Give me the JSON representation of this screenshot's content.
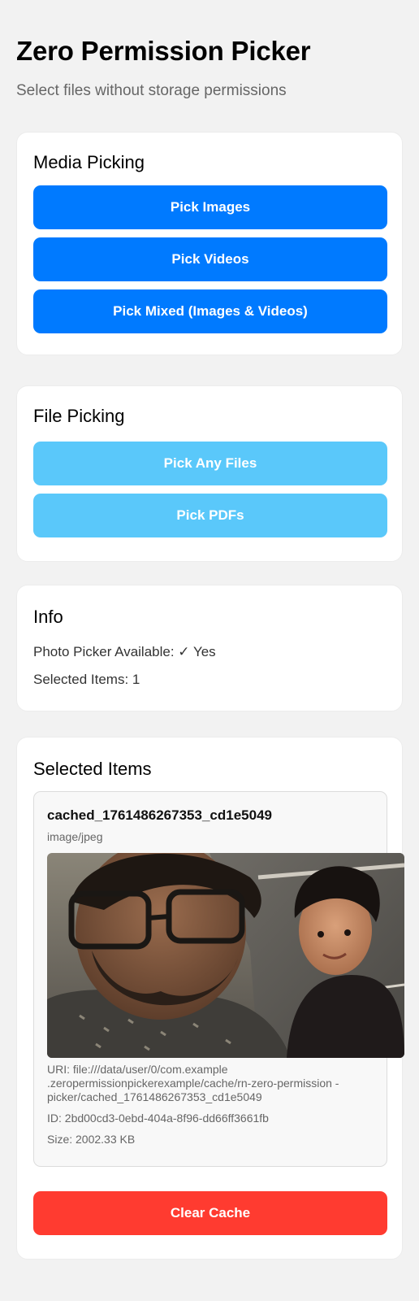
{
  "header": {
    "title": "Zero Permission Picker",
    "subtitle": "Select files without storage permissions"
  },
  "media_picking": {
    "title": "Media Picking",
    "buttons": [
      "Pick Images",
      "Pick Videos",
      "Pick Mixed (Images & Videos)"
    ]
  },
  "file_picking": {
    "title": "File Picking",
    "buttons": [
      "Pick Any Files",
      "Pick PDFs"
    ]
  },
  "info": {
    "title": "Info",
    "photo_picker": "Photo Picker Available: ✓ Yes",
    "selected_count": "Selected Items: 1"
  },
  "selected": {
    "title": "Selected Items",
    "items": [
      {
        "name": "cached_1761486267353_cd1e5049",
        "type": "image/jpeg",
        "uri": "URI: file:///data/user/0/com.example .zeropermissionpickerexample/cache/rn-zero-permission -picker/cached_1761486267353_cd1e5049",
        "id": "ID: 2bd00cd3-0ebd-404a-8f96-dd66ff3661fb",
        "size": "Size: 2002.33 KB"
      }
    ],
    "clear_label": "Clear Cache"
  },
  "colors": {
    "primary": "#007aff",
    "secondary": "#5ac8fa",
    "danger": "#ff3b30",
    "background": "#f2f2f2"
  }
}
